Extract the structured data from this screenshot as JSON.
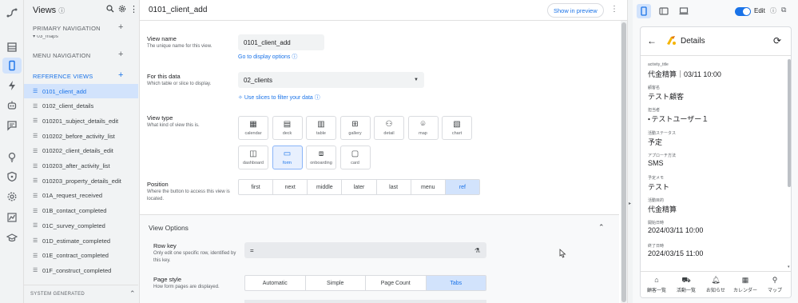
{
  "rail": {
    "icons": [
      "route-icon",
      "table-icon",
      "phone-icon",
      "bolt-icon",
      "robot-icon",
      "chat-icon",
      "bulb-icon",
      "shield-icon",
      "gear-icon",
      "chart-icon",
      "school-icon"
    ]
  },
  "views_panel": {
    "title": "Views",
    "primary_nav": "PRIMARY NAVIGATION",
    "truncated_item": "03_maps",
    "menu_nav": "MENU NAVIGATION",
    "reference_views": "REFERENCE VIEWS",
    "items": [
      "0101_client_add",
      "0102_client_details",
      "010201_subject_details_edit",
      "010202_before_activity_list",
      "010202_client_details_edit",
      "010203_after_activity_list",
      "010203_property_details_edit",
      "01A_request_received",
      "01B_contact_completed",
      "01C_survey_completed",
      "01D_estimate_completed",
      "01E_contract_completed",
      "01F_construct_completed"
    ],
    "footer": "SYSTEM GENERATED"
  },
  "editor": {
    "title": "0101_client_add",
    "show_preview": "Show in preview",
    "view_name_label": "View name",
    "view_name_sub": "The unique name for this view.",
    "view_name_value": "0101_client_add",
    "display_options_link": "Go to display options",
    "for_this_data_label": "For this data",
    "for_this_data_sub": "Which table or slice to display.",
    "for_this_data_value": "02_clients",
    "slices_link": "Use slices to filter your data",
    "view_type_label": "View type",
    "view_type_sub": "What kind of view this is.",
    "view_types": [
      "calendar",
      "deck",
      "table",
      "gallery",
      "detail",
      "map",
      "chart",
      "dashboard",
      "form",
      "onboarding",
      "card"
    ],
    "view_type_selected": "form",
    "position_label": "Position",
    "position_sub": "Where the button to access this view is located.",
    "positions": [
      "first",
      "next",
      "middle",
      "later",
      "last",
      "menu",
      "ref"
    ],
    "position_selected": "ref",
    "view_options": "View Options",
    "row_key_label": "Row key",
    "row_key_sub": "Only edit one specific row, identified by this key.",
    "row_key_value": "=",
    "page_style_label": "Page style",
    "page_style_sub": "How form pages are displayed.",
    "page_styles": [
      "Automatic",
      "Simple",
      "Page Count",
      "Tabs"
    ],
    "page_style_selected": "Tabs"
  },
  "preview": {
    "edit_label": "Edit",
    "header_title": "Details",
    "fields": [
      {
        "key": "activity_title",
        "value": "代金精算｜03/11 10:00"
      },
      {
        "key": "顧客名",
        "value": "テスト顧客"
      },
      {
        "key": "担当者",
        "value": "テストユーザー１"
      },
      {
        "key": "活動ステータス",
        "value": "予定"
      },
      {
        "key": "アプローチ方法",
        "value": "SMS"
      },
      {
        "key": "予定メモ",
        "value": "テスト"
      },
      {
        "key": "活動目的",
        "value": "代金精算"
      },
      {
        "key": "開始日時",
        "value": "2024/03/11 10:00"
      },
      {
        "key": "終了日時",
        "value": "2024/03/15 11:00"
      }
    ],
    "nav": [
      "顧客一覧",
      "活動一覧",
      "お知らせ",
      "カレンダー",
      "マップ"
    ]
  },
  "colors": {
    "accent": "#1a73e8",
    "selected_bg": "#d2e3fc",
    "panel_bg": "#f1f3f4"
  }
}
